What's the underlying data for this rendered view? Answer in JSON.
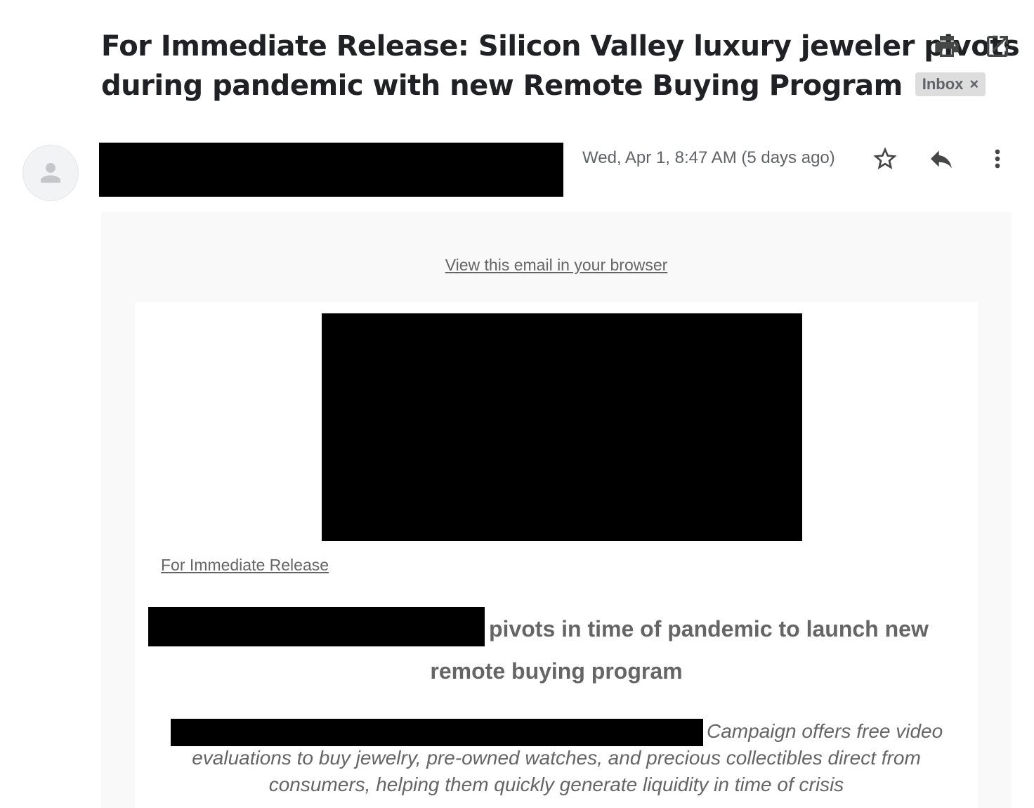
{
  "subject": {
    "line1": "For Immediate Release:  Silicon Valley luxury jeweler pivots",
    "line2": "during pandemic with new Remote Buying Program",
    "label_chip": "Inbox",
    "chip_close": "×"
  },
  "header_icons": [
    "print-icon",
    "open-in-new-window-icon"
  ],
  "message": {
    "date": "Wed, Apr 1, 8:47 AM (5 days ago)",
    "icons": [
      "star-icon",
      "reply-icon",
      "more-vert-icon"
    ],
    "avatar_icon": "person-icon"
  },
  "email_body": {
    "view_in_browser": "View this email in your browser",
    "release_link": "For Immediate Release",
    "headline_part1": "pivots in time of pandemic to launch new",
    "headline_part2": "remote buying program",
    "subhead_part1": "Campaign offers free video",
    "subhead_part2": "evaluations to buy jewelry, pre-owned watches, and precious collectibles direct from",
    "subhead_part3": "consumers, helping them quickly generate liquidity in time of crisis"
  },
  "colors": {
    "body_text_gray": "#656565",
    "date_gray": "#5f6368",
    "chip_bg": "#dddddd",
    "outer_bg": "#f9f9f9"
  }
}
